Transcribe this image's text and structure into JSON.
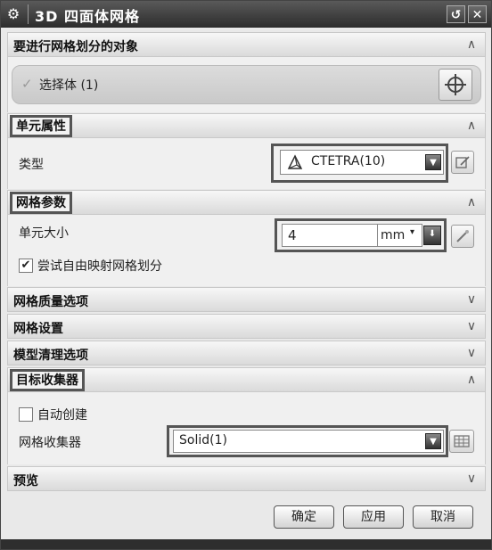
{
  "window": {
    "title": "3D 四面体网格",
    "controls": [
      "reset-icon",
      "close-icon"
    ]
  },
  "sections": {
    "objects": {
      "title": "要进行网格划分的对象",
      "select_body_label": "选择体 (1)"
    },
    "element_props": {
      "title": "单元属性",
      "type_label": "类型",
      "type_value": "CTETRA(10)"
    },
    "mesh_params": {
      "title": "网格参数",
      "element_size_label": "单元大小",
      "element_size_value": "4",
      "unit": "mm",
      "try_free_map_label": "尝试自由映射网格划分",
      "try_free_map_checked": true
    },
    "mesh_quality": {
      "title": "网格质量选项"
    },
    "mesh_settings": {
      "title": "网格设置"
    },
    "model_cleanup": {
      "title": "模型清理选项"
    },
    "target_collector": {
      "title": "目标收集器",
      "auto_create_label": "自动创建",
      "auto_create_checked": false,
      "mesh_collector_label": "网格收集器",
      "mesh_collector_value": "Solid(1)"
    },
    "preview": {
      "title": "预览"
    }
  },
  "buttons": {
    "ok": "确定",
    "apply": "应用",
    "cancel": "取消"
  }
}
